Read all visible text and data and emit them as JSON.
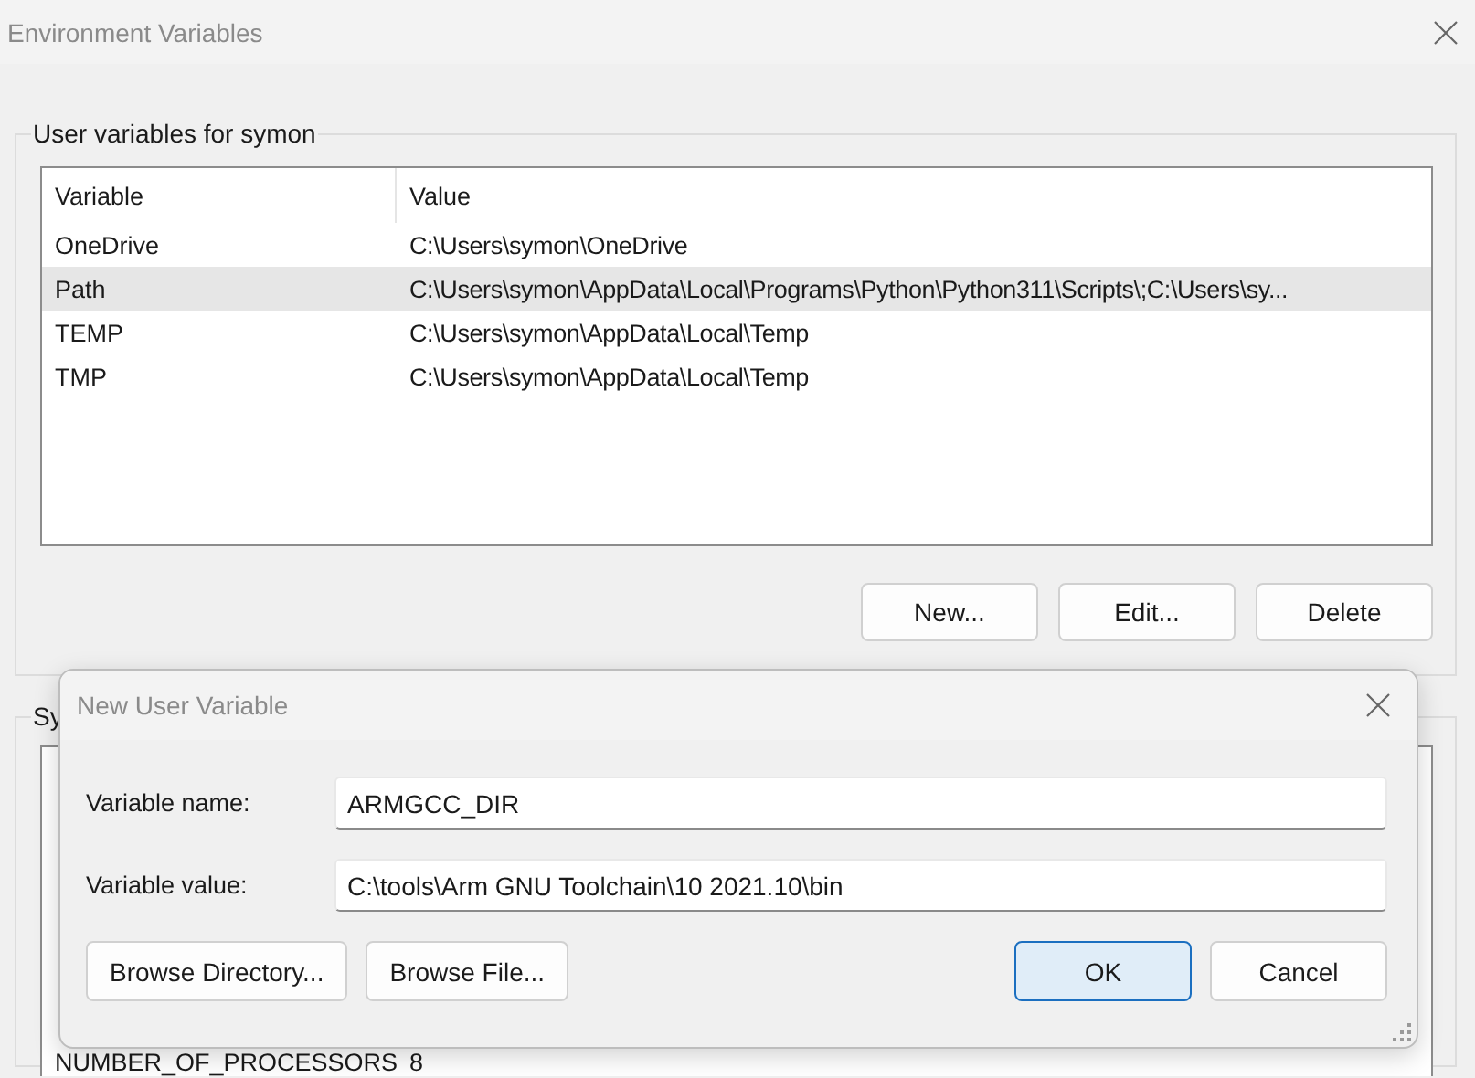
{
  "window": {
    "title": "Environment Variables"
  },
  "user_variables": {
    "title": "User variables for symon",
    "columns": [
      "Variable",
      "Value"
    ],
    "rows": [
      {
        "variable": "OneDrive",
        "value": "C:\\Users\\symon\\OneDrive",
        "selected": false
      },
      {
        "variable": "Path",
        "value": "C:\\Users\\symon\\AppData\\Local\\Programs\\Python\\Python311\\Scripts\\;C:\\Users\\sy...",
        "selected": true
      },
      {
        "variable": "TEMP",
        "value": "C:\\Users\\symon\\AppData\\Local\\Temp",
        "selected": false
      },
      {
        "variable": "TMP",
        "value": "C:\\Users\\symon\\AppData\\Local\\Temp",
        "selected": false
      }
    ],
    "buttons": [
      "New...",
      "Edit...",
      "Delete"
    ]
  },
  "system_variables": {
    "title": "Sy",
    "rows": [
      {
        "variable": "NUMBER_OF_PROCESSORS",
        "value": "8"
      }
    ]
  },
  "dialog": {
    "title": "New User Variable",
    "fields": [
      {
        "label": "Variable name:",
        "value": "ARMGCC_DIR"
      },
      {
        "label": "Variable value:",
        "value": "C:\\tools\\Arm GNU Toolchain\\10 2021.10\\bin"
      }
    ],
    "left_buttons": [
      "Browse Directory...",
      "Browse File..."
    ],
    "right_buttons": [
      {
        "label": "OK",
        "default": true
      },
      {
        "label": "Cancel",
        "default": false
      }
    ]
  }
}
